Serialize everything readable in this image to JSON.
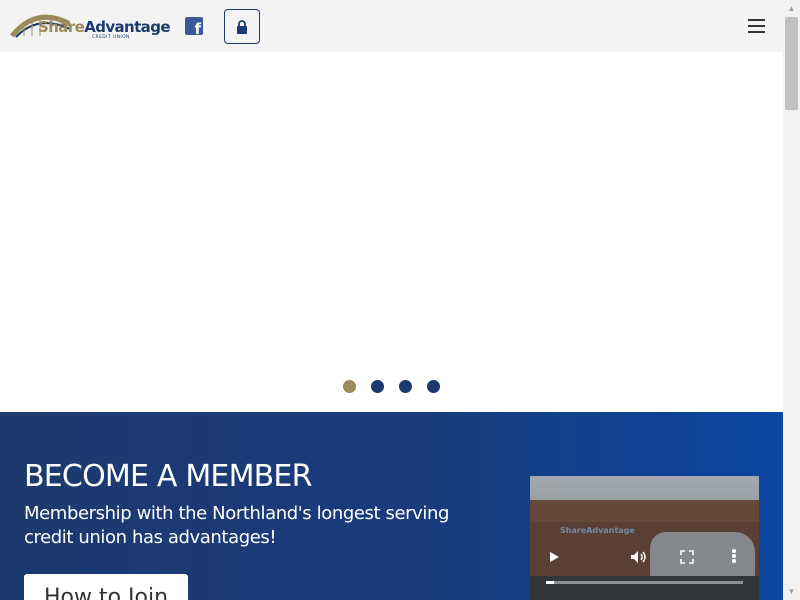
{
  "header": {
    "logo": {
      "word_share": "Share",
      "word_advantage": "Advantage",
      "tagline": "CREDIT UNION"
    },
    "facebook_icon": "facebook-icon",
    "login_icon": "lock-icon",
    "menu_icon": "hamburger-menu-icon"
  },
  "carousel": {
    "slide_count": 4,
    "active_index": 0,
    "colors": {
      "active": "#9c8a5a",
      "inactive": "#1d3a6e"
    }
  },
  "member": {
    "title": "BECOME A MEMBER",
    "subtitle": "Membership with the Northland's longest serving credit union has advantages!",
    "button_label": "How to Join",
    "video": {
      "sign_text": "ShareAdvantage",
      "controls": [
        "play-icon",
        "volume-icon",
        "fullscreen-icon",
        "more-options-icon"
      ],
      "progress": 0.04
    }
  },
  "colors": {
    "brand_navy": "#1d3a6e",
    "brand_gold": "#9c8a5a",
    "header_bg": "#f3f3f3"
  }
}
